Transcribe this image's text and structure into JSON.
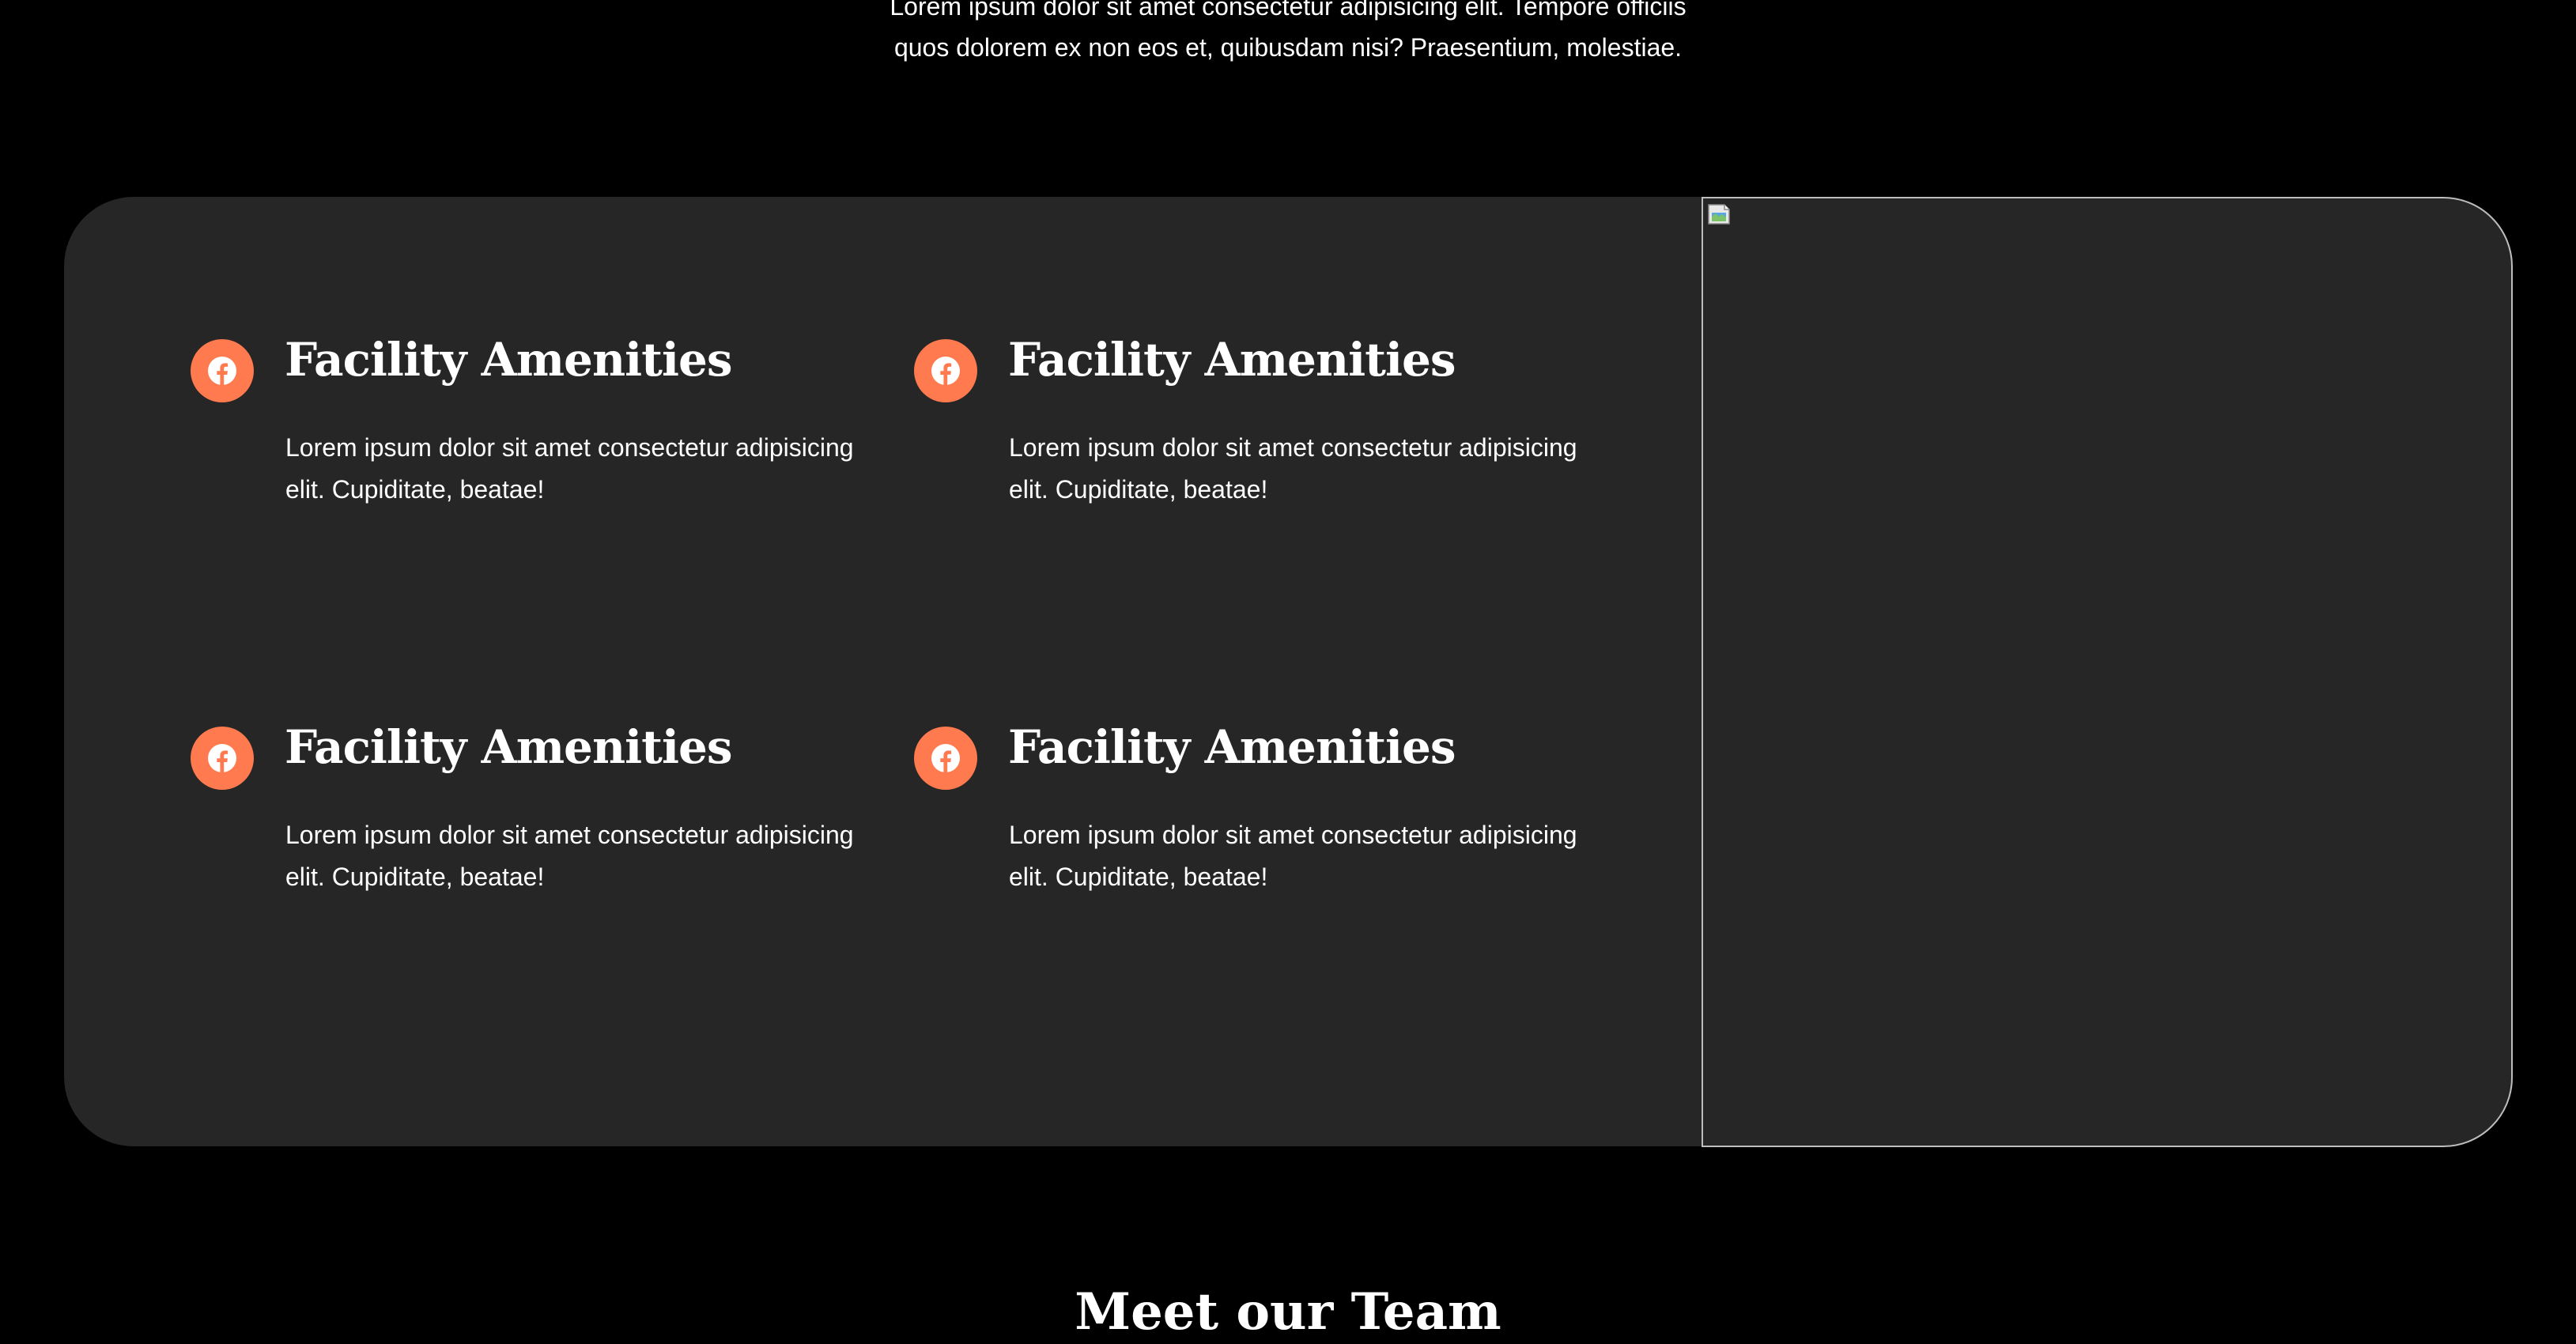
{
  "intro": {
    "line1": "Lorem ipsum dolor sit amet consectetur adipisicing elit. Tempore officiis",
    "line2": "quos dolorem ex non eos et, quibusdam nisi? Praesentium, molestiae."
  },
  "features": [
    {
      "icon": "facebook-icon",
      "title": "Facility Amenities",
      "text": "Lorem ipsum dolor sit amet consectetur adipisicing elit. Cupiditate, beatae!"
    },
    {
      "icon": "facebook-icon",
      "title": "Facility Amenities",
      "text": "Lorem ipsum dolor sit amet consectetur adipisicing elit. Cupiditate, beatae!"
    },
    {
      "icon": "facebook-icon",
      "title": "Facility Amenities",
      "text": "Lorem ipsum dolor sit amet consectetur adipisicing elit. Cupiditate, beatae!"
    },
    {
      "icon": "facebook-icon",
      "title": "Facility Amenities",
      "text": "Lorem ipsum dolor sit amet consectetur adipisicing elit. Cupiditate, beatae!"
    }
  ],
  "image": {
    "icon": "broken-image-icon"
  },
  "next_section": {
    "title": "Meet our Team"
  },
  "colors": {
    "page_background": "#000000",
    "card_background": "#262626",
    "accent": "#ff7a4f",
    "text": "#ffffff",
    "image_border": "#bdbdbd"
  }
}
